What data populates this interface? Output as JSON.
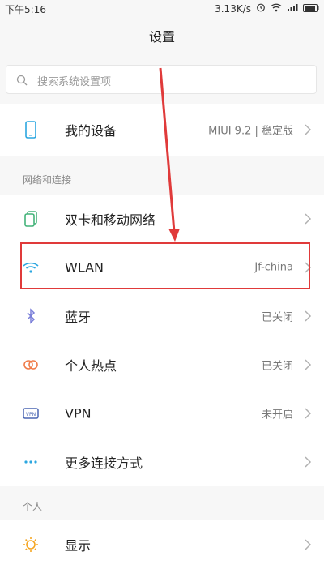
{
  "status": {
    "time": "下午5:16",
    "speed": "3.13K/s",
    "battery": "",
    "icons": [
      "alarm-icon",
      "wifi-icon",
      "signal-icon",
      "battery-icon"
    ]
  },
  "header": {
    "title": "设置"
  },
  "search": {
    "placeholder": "搜索系统设置项"
  },
  "device": {
    "label": "我的设备",
    "value": "MIUI 9.2 | 稳定版"
  },
  "section_network": {
    "title": "网络和连接"
  },
  "network_items": [
    {
      "label": "双卡和移动网络",
      "value": "",
      "icon": "sim-card-icon"
    },
    {
      "label": "WLAN",
      "value": "Jf-china",
      "icon": "wifi-icon"
    },
    {
      "label": "蓝牙",
      "value": "已关闭",
      "icon": "bluetooth-icon"
    },
    {
      "label": "个人热点",
      "value": "已关闭",
      "icon": "hotspot-icon"
    },
    {
      "label": "VPN",
      "value": "未开启",
      "icon": "vpn-icon"
    },
    {
      "label": "更多连接方式",
      "value": "",
      "icon": "more-icon"
    }
  ],
  "section_personal": {
    "title": "个人"
  },
  "personal_items": [
    {
      "label": "显示",
      "value": "",
      "icon": "display-icon"
    }
  ],
  "colors": {
    "accent": "#2ca7e0",
    "annotation": "#e03a3a"
  }
}
